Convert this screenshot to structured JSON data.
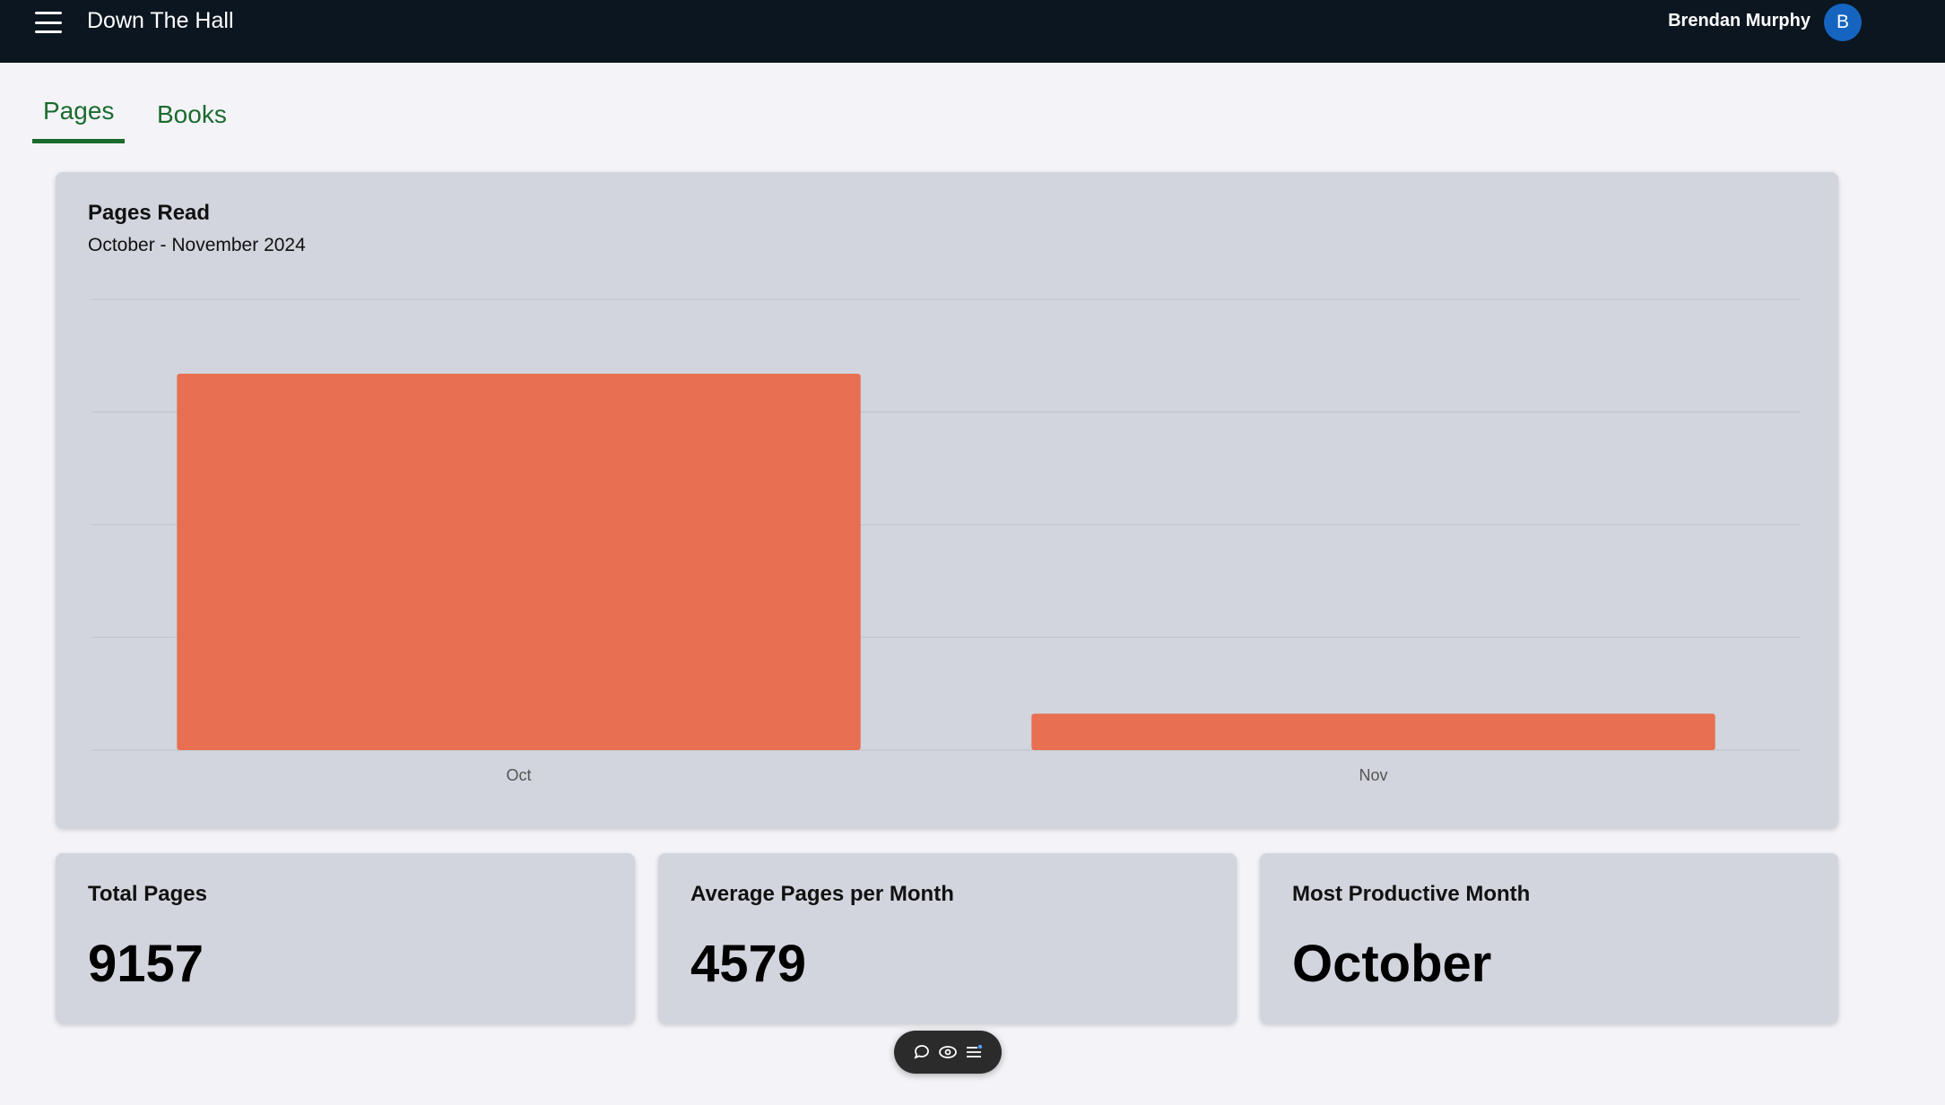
{
  "header": {
    "app_title": "Down The Hall",
    "user_name": "Brendan Murphy",
    "avatar_initial": "B"
  },
  "tabs": [
    {
      "label": "Pages",
      "active": true
    },
    {
      "label": "Books",
      "active": false
    }
  ],
  "chart_card": {
    "title": "Pages Read",
    "subtitle": "October - November 2024"
  },
  "chart_data": {
    "type": "bar",
    "title": "Pages Read",
    "subtitle": "October - November 2024",
    "categories": [
      "Oct",
      "Nov"
    ],
    "values": [
      8350,
      807
    ],
    "ylim": [
      0,
      10000
    ],
    "grid": true,
    "bar_color": "#e86f52"
  },
  "stats": [
    {
      "label": "Total Pages",
      "value": "9157"
    },
    {
      "label": "Average Pages per Month",
      "value": "4579"
    },
    {
      "label": "Most Productive Month",
      "value": "October"
    }
  ],
  "toolbar": {
    "icons": [
      "comment-icon",
      "eye-icon",
      "list-icon"
    ]
  },
  "colors": {
    "header_bg": "#0b1620",
    "accent_green": "#1b6b2f",
    "avatar_blue": "#1565c0",
    "card_bg": "#d2d5dd"
  }
}
